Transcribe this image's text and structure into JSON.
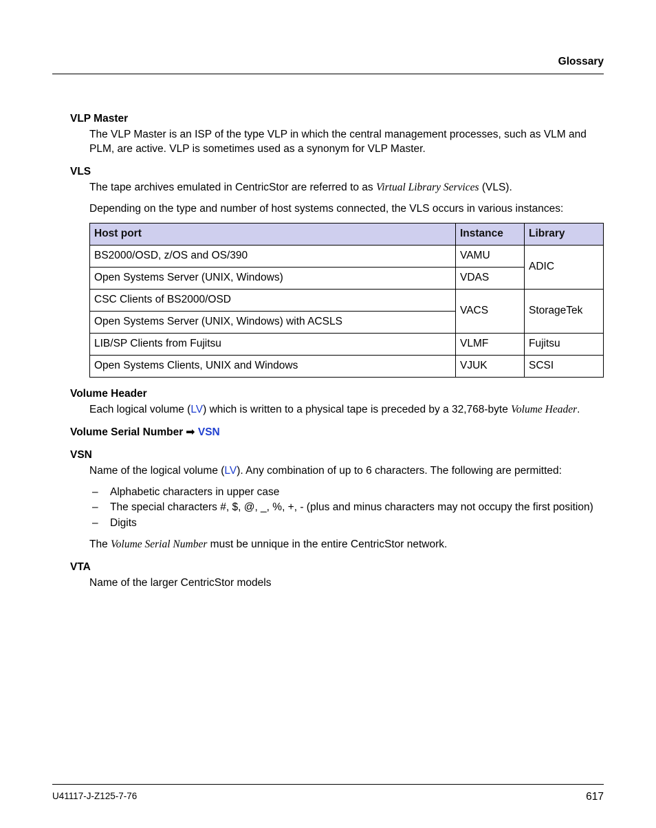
{
  "header": {
    "title": "Glossary"
  },
  "entries": {
    "vlp_master": {
      "term": "VLP Master",
      "def": "The VLP Master is an ISP of the type VLP in which the central management processes, such as VLM and PLM, are active. VLP is sometimes used as a synonym for VLP Master."
    },
    "vls": {
      "term": "VLS",
      "def1a": "The tape archives emulated in CentricStor are referred to as ",
      "def1b_italic": "Virtual Library Services",
      "def1c": " (VLS).",
      "def2": "Depending on the type and number of host systems connected, the VLS occurs in various instances:",
      "table": {
        "headers": {
          "host": "Host port",
          "instance": "Instance",
          "library": "Library"
        },
        "groups": [
          {
            "library": "ADIC",
            "rows": [
              {
                "host": "BS2000/OSD, z/OS and OS/390",
                "instance": "VAMU"
              },
              {
                "host": "Open Systems Server (UNIX, Windows)",
                "instance": "VDAS"
              }
            ]
          },
          {
            "library": "StorageTek",
            "rows": [
              {
                "host": "CSC Clients of BS2000/OSD",
                "instance": "VACS"
              },
              {
                "host": "Open Systems Server (UNIX, Windows) with ACSLS",
                "instance": ""
              }
            ]
          },
          {
            "library": "Fujitsu",
            "rows": [
              {
                "host": "LIB/SP Clients from Fujitsu",
                "instance": "VLMF"
              }
            ]
          },
          {
            "library": "SCSI",
            "rows": [
              {
                "host": "Open Systems Clients, UNIX and Windows",
                "instance": "VJUK"
              }
            ]
          }
        ]
      }
    },
    "volume_header": {
      "term": "Volume Header",
      "def_a": "Each logical volume (",
      "def_link": "LV",
      "def_b": ") which is written to a physical tape is preceded by a 32,768-byte ",
      "def_italic": "Volume Header",
      "def_c": "."
    },
    "vsn_ref": {
      "term_a": "Volume Serial Number ",
      "arrow": "➟",
      "term_link": " VSN"
    },
    "vsn": {
      "term": "VSN",
      "def_a": "Name of the logical volume (",
      "def_link": "LV",
      "def_b": "). Any combination of up to 6 characters. The following are permitted:",
      "bullets": {
        "b1": "Alphabetic characters in upper case",
        "b2": "The special characters #, $, @, _, %, +, - (plus and minus characters may not occupy the first position)",
        "b3": "Digits"
      },
      "def2a": "The ",
      "def2b_italic": "Volume Serial Number",
      "def2c": " must be unnique in the entire CentricStor network."
    },
    "vta": {
      "term": "VTA",
      "def": "Name of the larger CentricStor models"
    }
  },
  "footer": {
    "docnum": "U41117-J-Z125-7-76",
    "pagenum": "617"
  }
}
